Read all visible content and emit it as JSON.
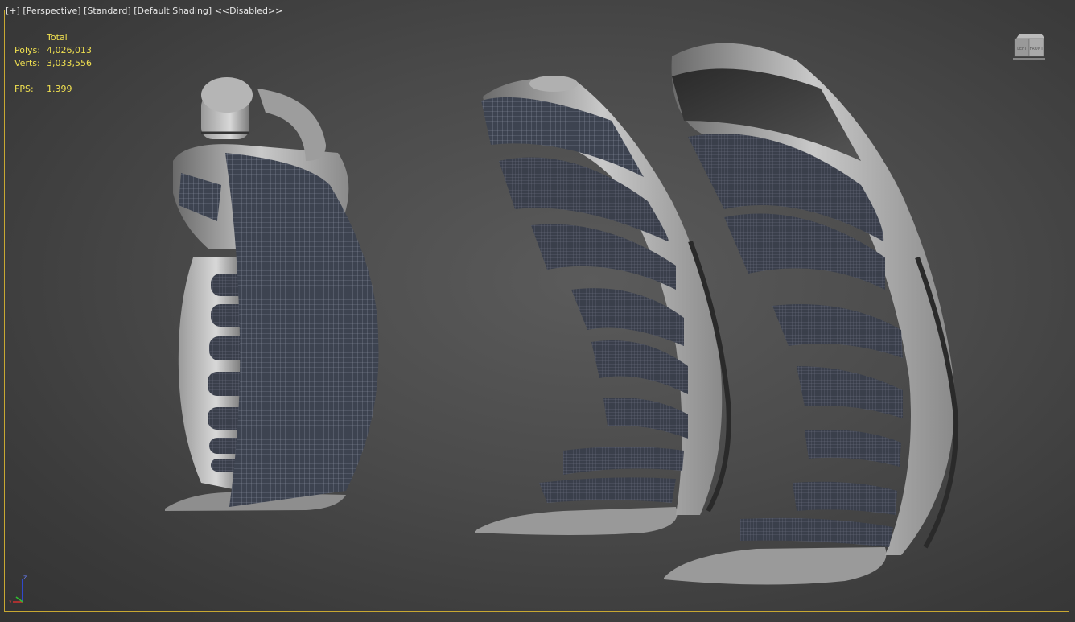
{
  "viewport": {
    "labels": {
      "plus": "[+]",
      "view": "[Perspective]",
      "mode": "[Standard]",
      "shading": "[Default Shading]",
      "status": "<<Disabled>>"
    },
    "stats": {
      "header": "Total",
      "polys_label": "Polys:",
      "polys_value": "4,026,013",
      "verts_label": "Verts:",
      "verts_value": "3,033,556",
      "fps_label": "FPS:",
      "fps_value": "1.399"
    },
    "viewcube": {
      "left": "LEFT",
      "front": "FRONT"
    },
    "axis": {
      "z": "z",
      "x": "x"
    }
  },
  "colors": {
    "border": "#c8a832",
    "stats_text": "#f0e050",
    "label_text": "#e6e6e6"
  }
}
